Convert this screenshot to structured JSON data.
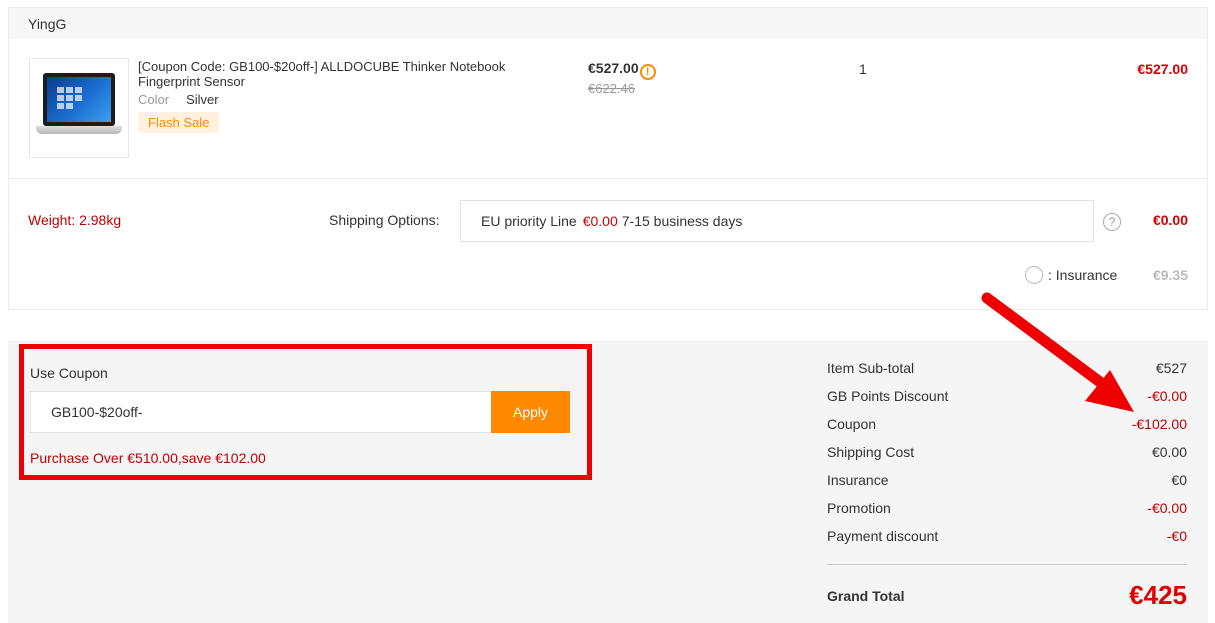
{
  "store": {
    "name": "YingG"
  },
  "product": {
    "title": "[Coupon Code: GB100-$20off-] ALLDOCUBE Thinker Notebook Fingerprint Sensor",
    "attr_label": "Color",
    "attr_value": "Silver",
    "badge": "Flash Sale",
    "price_now": "€527.00",
    "price_old": "€622.46",
    "quantity": "1",
    "line_total": "€527.00"
  },
  "shipping": {
    "weight": "Weight: 2.98kg",
    "label": "Shipping Options:",
    "method": "EU priority Line",
    "fee": "€0.00",
    "days": "7-15 business days",
    "cost": "€0.00",
    "insurance_label": ": Insurance",
    "insurance_cost": "€9.35"
  },
  "coupon": {
    "title": "Use Coupon",
    "code": "GB100-$20off-",
    "apply_label": "Apply",
    "message": "Purchase Over €510.00,save €102.00"
  },
  "summary": {
    "rows": [
      {
        "label": "Item Sub-total",
        "value": "€527"
      },
      {
        "label": "GB Points Discount",
        "value": "-€0.00"
      },
      {
        "label": "Coupon",
        "value": "-€102.00"
      },
      {
        "label": "Shipping Cost",
        "value": "€0.00"
      },
      {
        "label": "Insurance",
        "value": "€0"
      },
      {
        "label": "Promotion",
        "value": "-€0.00"
      },
      {
        "label": "Payment discount",
        "value": "-€0"
      }
    ],
    "grand_total_label": "Grand Total",
    "grand_total_value": "€425"
  },
  "colors": {
    "accent": "#ff8a00",
    "price_red": "#d00000",
    "annotation_red": "#ee0000"
  }
}
